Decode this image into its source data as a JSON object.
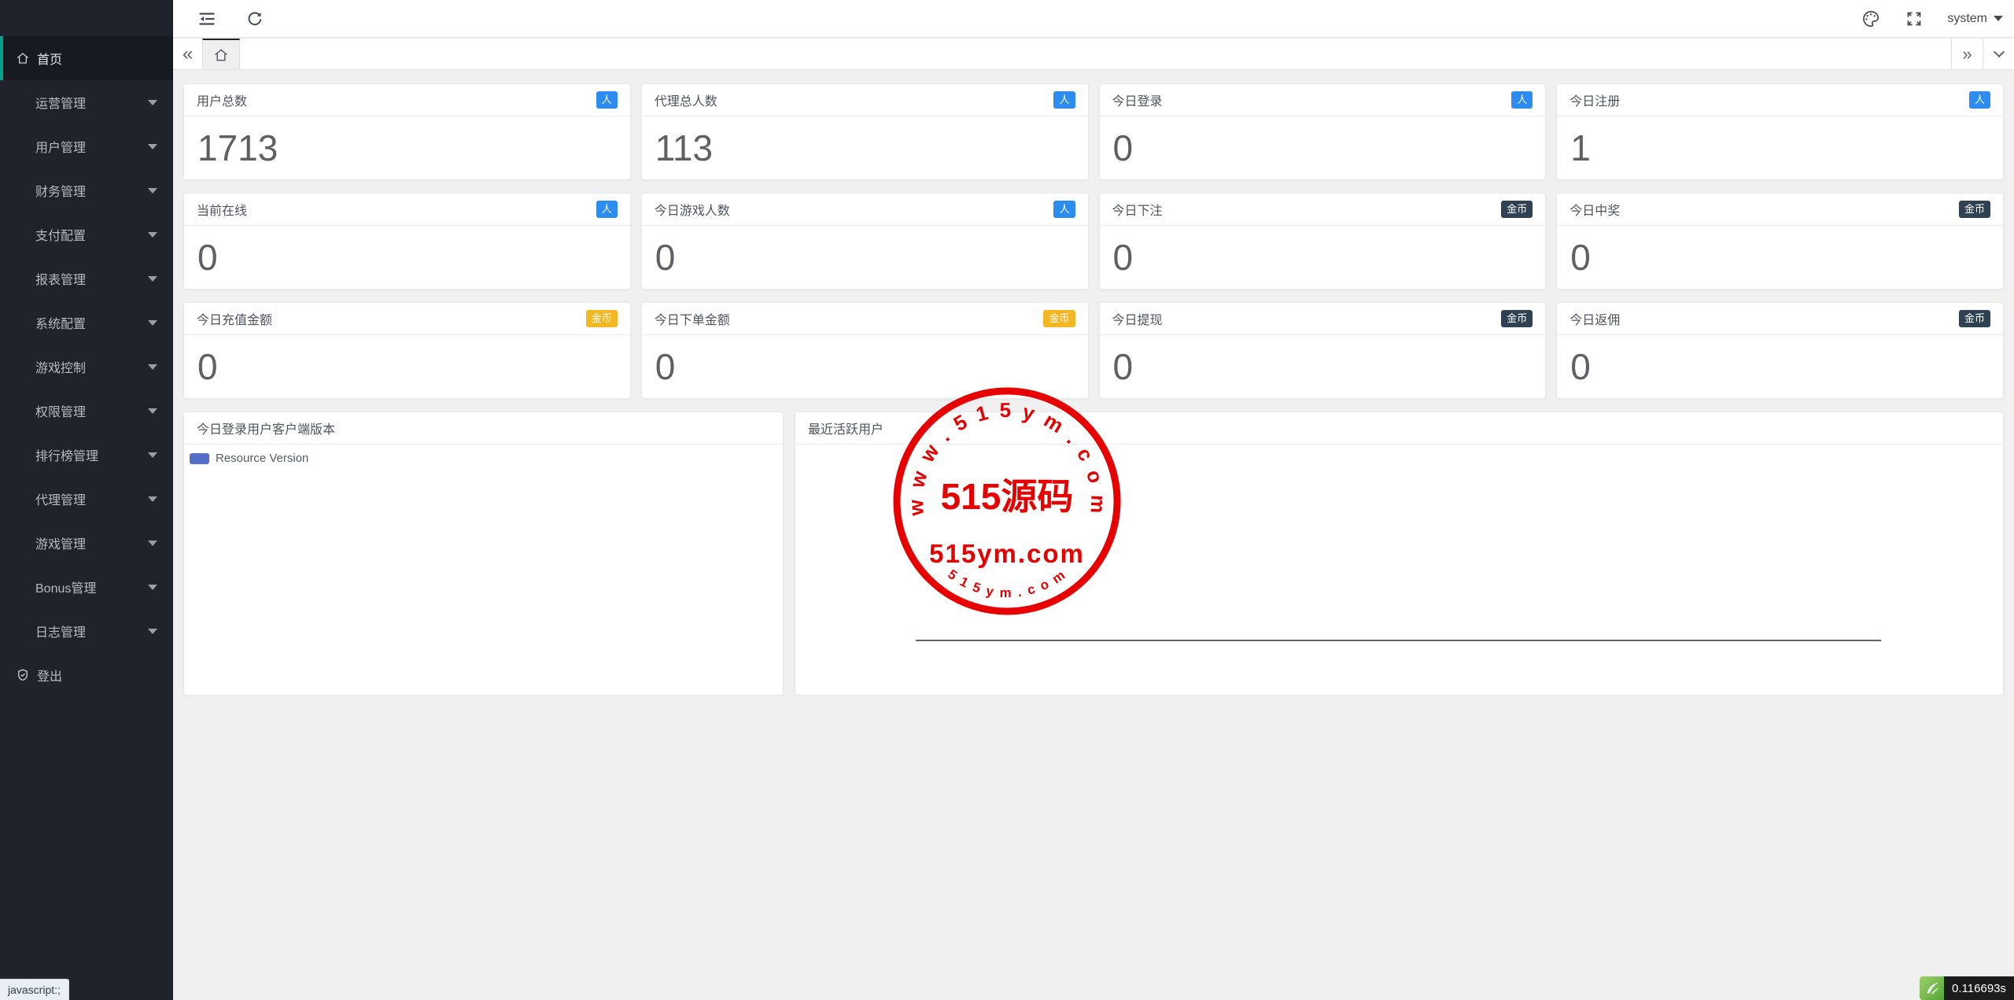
{
  "topbar": {
    "username": "system"
  },
  "sidebar": {
    "items": [
      {
        "label": "首页"
      },
      {
        "label": "运营管理"
      },
      {
        "label": "用户管理"
      },
      {
        "label": "财务管理"
      },
      {
        "label": "支付配置"
      },
      {
        "label": "报表管理"
      },
      {
        "label": "系统配置"
      },
      {
        "label": "游戏控制"
      },
      {
        "label": "权限管理"
      },
      {
        "label": "排行榜管理"
      },
      {
        "label": "代理管理"
      },
      {
        "label": "游戏管理"
      },
      {
        "label": "Bonus管理"
      },
      {
        "label": "日志管理"
      },
      {
        "label": "登出"
      }
    ]
  },
  "stat_cards": [
    {
      "title": "用户总数",
      "value": "1713",
      "badge": "人",
      "badge_color": "#2d8cf0"
    },
    {
      "title": "代理总人数",
      "value": "113",
      "badge": "人",
      "badge_color": "#2d8cf0"
    },
    {
      "title": "今日登录",
      "value": "0",
      "badge": "人",
      "badge_color": "#2d8cf0"
    },
    {
      "title": "今日注册",
      "value": "1",
      "badge": "人",
      "badge_color": "#2d8cf0"
    },
    {
      "title": "当前在线",
      "value": "0",
      "badge": "人",
      "badge_color": "#2d8cf0"
    },
    {
      "title": "今日游戏人数",
      "value": "0",
      "badge": "人",
      "badge_color": "#2d8cf0"
    },
    {
      "title": "今日下注",
      "value": "0",
      "badge": "金币",
      "badge_color": "#2f4254"
    },
    {
      "title": "今日中奖",
      "value": "0",
      "badge": "金币",
      "badge_color": "#2f4254"
    },
    {
      "title": "今日充值金额",
      "value": "0",
      "badge": "金币",
      "badge_color": "#f2b723"
    },
    {
      "title": "今日下单金额",
      "value": "0",
      "badge": "金币",
      "badge_color": "#f2b723"
    },
    {
      "title": "今日提现",
      "value": "0",
      "badge": "金币",
      "badge_color": "#2f4254"
    },
    {
      "title": "今日返佣",
      "value": "0",
      "badge": "金币",
      "badge_color": "#2f4254"
    }
  ],
  "panels": {
    "client_version": {
      "title": "今日登录用户客户端版本",
      "legend": "Resource Version",
      "legend_color": "#5470c6"
    },
    "active_users": {
      "title": "最近活跃用户"
    }
  },
  "watermark": {
    "arc_top": "w w w . 5 1 5 y m . c o m",
    "center_line1": "515源码",
    "center_line2": "515ym.com",
    "arc_bottom": "5 1 5 y m . c o m",
    "color": "#e60000"
  },
  "statusbar": {
    "link_hint": "javascript:;",
    "render_time": "0.116693s"
  },
  "colors": {
    "sidebar_active_accent": "#00a28d"
  }
}
